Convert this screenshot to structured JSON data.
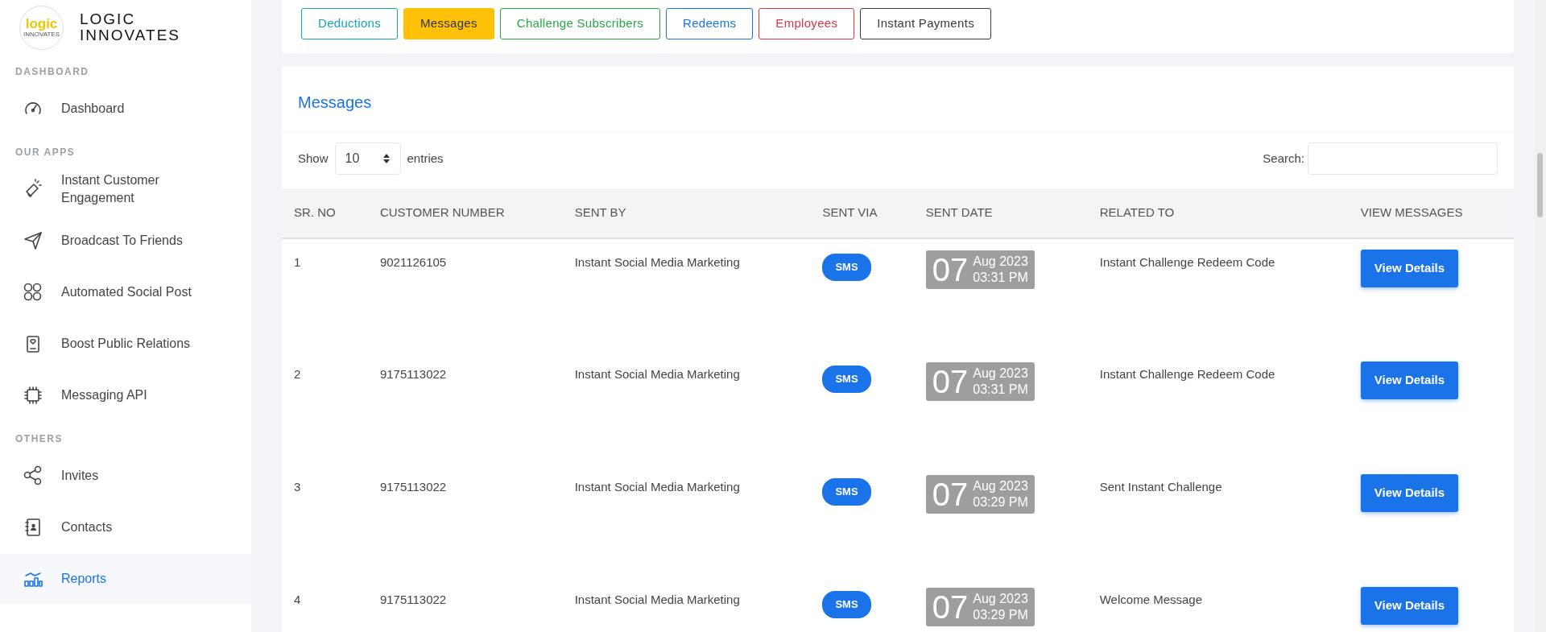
{
  "brand": {
    "name_lines": [
      "LOGIC",
      "INNOVATES"
    ],
    "logo_text": "logic",
    "logo_subtext": "INNOVATES"
  },
  "sidebar": {
    "sections": [
      {
        "heading": "DASHBOARD",
        "items": [
          {
            "label": "Dashboard",
            "selected": false
          }
        ]
      },
      {
        "heading": "OUR APPS",
        "items": [
          {
            "label": "Instant Customer Engagement",
            "selected": false
          },
          {
            "label": "Broadcast To Friends",
            "selected": false
          },
          {
            "label": "Automated Social Post",
            "selected": false
          },
          {
            "label": "Boost Public Relations",
            "selected": false
          },
          {
            "label": "Messaging API",
            "selected": false
          }
        ]
      },
      {
        "heading": "OTHERS",
        "items": [
          {
            "label": "Invites",
            "selected": false
          },
          {
            "label": "Contacts",
            "selected": false
          },
          {
            "label": "Reports",
            "selected": true
          }
        ]
      }
    ]
  },
  "tabs": [
    {
      "label": "Deductions",
      "color": "#17a2b8",
      "selected": false
    },
    {
      "label": "Messages",
      "color": "#ffc107",
      "selected": true
    },
    {
      "label": "Challenge Subscribers",
      "color": "#28a745",
      "selected": false
    },
    {
      "label": "Redeems",
      "color": "#1a73e8",
      "selected": false
    },
    {
      "label": "Employees",
      "color": "#dc3545",
      "selected": false
    },
    {
      "label": "Instant Payments",
      "color": "#343a40",
      "selected": false
    }
  ],
  "panel": {
    "title": "Messages",
    "show_label": "Show",
    "page_size": "10",
    "entries_label": "entries",
    "search_label": "Search:"
  },
  "table": {
    "columns": [
      "SR. NO",
      "CUSTOMER NUMBER",
      "SENT BY",
      "SENT VIA",
      "SENT DATE",
      "RELATED TO",
      "VIEW MESSAGES"
    ],
    "rows": [
      {
        "sr": "1",
        "customer_number": "9021126105",
        "sent_by": "Instant Social Media Marketing",
        "sent_via": "SMS",
        "date": {
          "day": "07",
          "month_year": "Aug 2023",
          "time": "03:31 PM"
        },
        "related_to": "Instant Challenge Redeem Code",
        "action": "View Details"
      },
      {
        "sr": "2",
        "customer_number": "9175113022",
        "sent_by": "Instant Social Media Marketing",
        "sent_via": "SMS",
        "date": {
          "day": "07",
          "month_year": "Aug 2023",
          "time": "03:31 PM"
        },
        "related_to": "Instant Challenge Redeem Code",
        "action": "View Details"
      },
      {
        "sr": "3",
        "customer_number": "9175113022",
        "sent_by": "Instant Social Media Marketing",
        "sent_via": "SMS",
        "date": {
          "day": "07",
          "month_year": "Aug 2023",
          "time": "03:29 PM"
        },
        "related_to": "Sent Instant Challenge",
        "action": "View Details"
      },
      {
        "sr": "4",
        "customer_number": "9175113022",
        "sent_by": "Instant Social Media Marketing",
        "sent_via": "SMS",
        "date": {
          "day": "07",
          "month_year": "Aug 2023",
          "time": "03:29 PM"
        },
        "related_to": "Welcome Message",
        "action": "View Details"
      }
    ]
  }
}
